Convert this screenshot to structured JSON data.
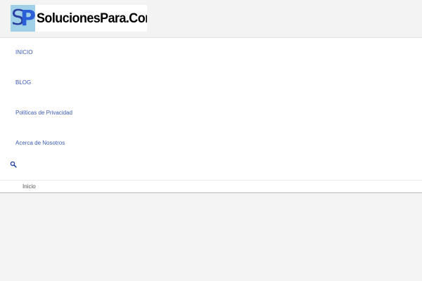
{
  "logo": {
    "mark_letters": [
      "S",
      "P"
    ],
    "text": "SolucionesPara.Com"
  },
  "nav": {
    "items": [
      {
        "label": "INICIO"
      },
      {
        "label": "BLOG"
      },
      {
        "label": "Políticas de Privacidad"
      },
      {
        "label": "Acerca de Nosotros"
      }
    ],
    "search_icon": "search-icon"
  },
  "breadcrumb": {
    "items": [
      "Inicio"
    ]
  },
  "colors": {
    "link": "#3b5ab5",
    "background": "#f4f4f4",
    "logo_mark_bg": "#9fd0e8"
  }
}
